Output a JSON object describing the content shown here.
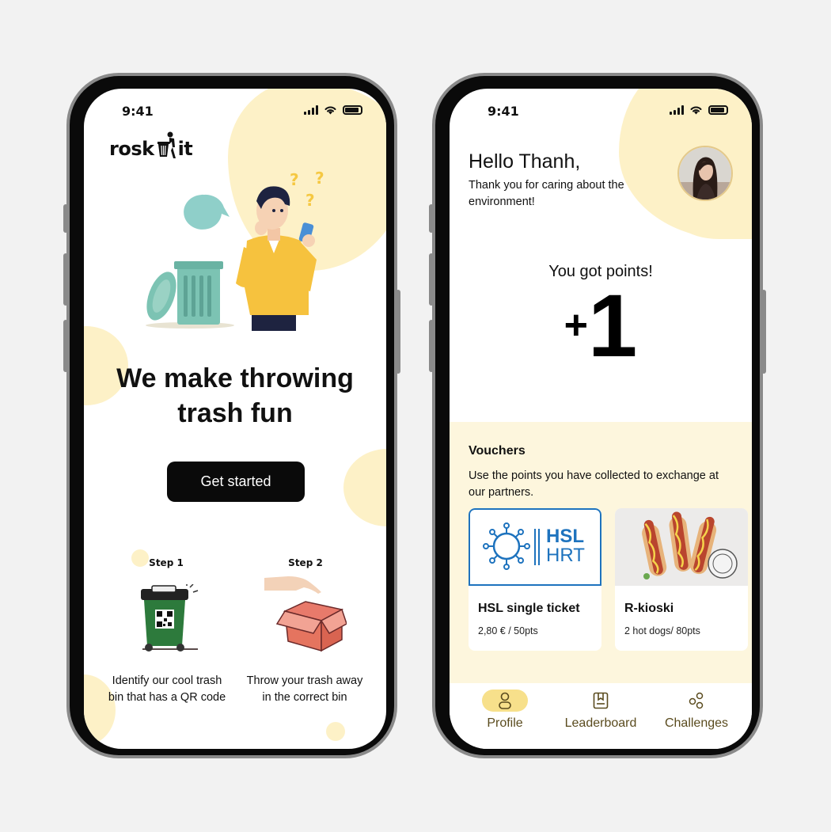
{
  "colors": {
    "accent_yellow": "#fdf1c7",
    "nav_active_pill": "#f7e08b",
    "primary_button": "#0a0a0a",
    "hsl_blue": "#1e73be",
    "nav_text": "#5a4b1e"
  },
  "status_bar": {
    "time": "9:41"
  },
  "onboarding": {
    "logo_text_left": "rosk",
    "logo_text_right": "it",
    "headline": "We make throwing trash fun",
    "cta_label": "Get started",
    "steps": [
      {
        "label": "Step 1",
        "description": "Identify our cool trash bin that has a QR code"
      },
      {
        "label": "Step 2",
        "description": "Throw your trash away in the correct bin"
      }
    ]
  },
  "home": {
    "greeting": "Hello Thanh,",
    "subtitle": "Thank you for caring about the environment!",
    "points_title": "You got points!",
    "points_sign": "+",
    "points_value": "1",
    "vouchers": {
      "title": "Vouchers",
      "subtitle": "Use the points you have collected to exchange at our partners.",
      "items": [
        {
          "name": "HSL single ticket",
          "price": "2,80 € / 50pts",
          "logo_top": "HSL",
          "logo_bottom": "HRT"
        },
        {
          "name": "R-kioski",
          "price": "2 hot dogs/ 80pts"
        }
      ]
    },
    "nav": [
      {
        "label": "Profile",
        "icon": "person-icon",
        "active": true
      },
      {
        "label": "Leaderboard",
        "icon": "bookmark-icon",
        "active": false
      },
      {
        "label": "Challenges",
        "icon": "circles-icon",
        "active": false
      }
    ]
  }
}
